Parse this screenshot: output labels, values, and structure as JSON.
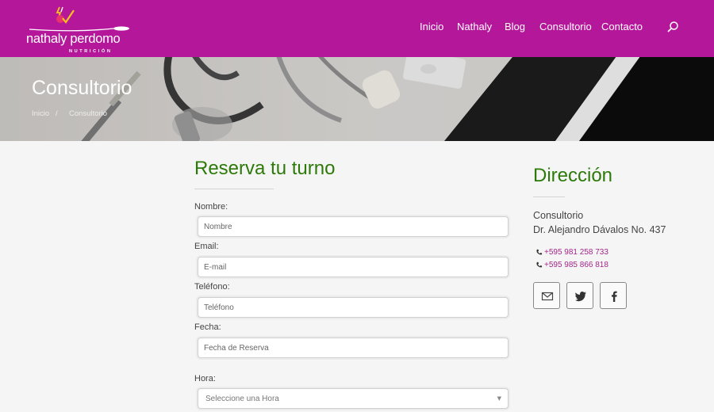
{
  "brand": {
    "name": "nathaly perdomo",
    "subtitle": "NUTRICIÓN"
  },
  "nav": {
    "items": [
      "Inicio",
      "Nathaly",
      "Blog",
      "Consultorio",
      "Contacto"
    ],
    "search_icon": "search-icon"
  },
  "hero": {
    "title": "Consultorio",
    "breadcrumb": [
      "Inicio",
      "/",
      "Consultorio"
    ]
  },
  "form": {
    "title": "Reserva tu turno",
    "fields": [
      {
        "label": "Nombre:",
        "placeholder": "Nombre"
      },
      {
        "label": "Email:",
        "placeholder": "E-mail"
      },
      {
        "label": "Teléfono:",
        "placeholder": "Teléfono"
      },
      {
        "label": "Fecha:",
        "placeholder": "Fecha de Reserva"
      }
    ],
    "hora": {
      "label": "Hora:",
      "selected": "Seleccione una Hora"
    }
  },
  "sidebar": {
    "title": "Dirección",
    "address_line1": "Consultorio",
    "address_line2": "Dr. Alejandro Dávalos No. 437",
    "phones": [
      "+595 981 258 733",
      "+595 985 866 818"
    ],
    "social_icons": [
      "mail-icon",
      "twitter-icon",
      "facebook-icon"
    ]
  },
  "colors": {
    "brand_magenta": "#b5179b",
    "heading_green": "#2d7a0a",
    "link_magenta": "#a3268c",
    "page_bg": "#f5f5f5"
  }
}
